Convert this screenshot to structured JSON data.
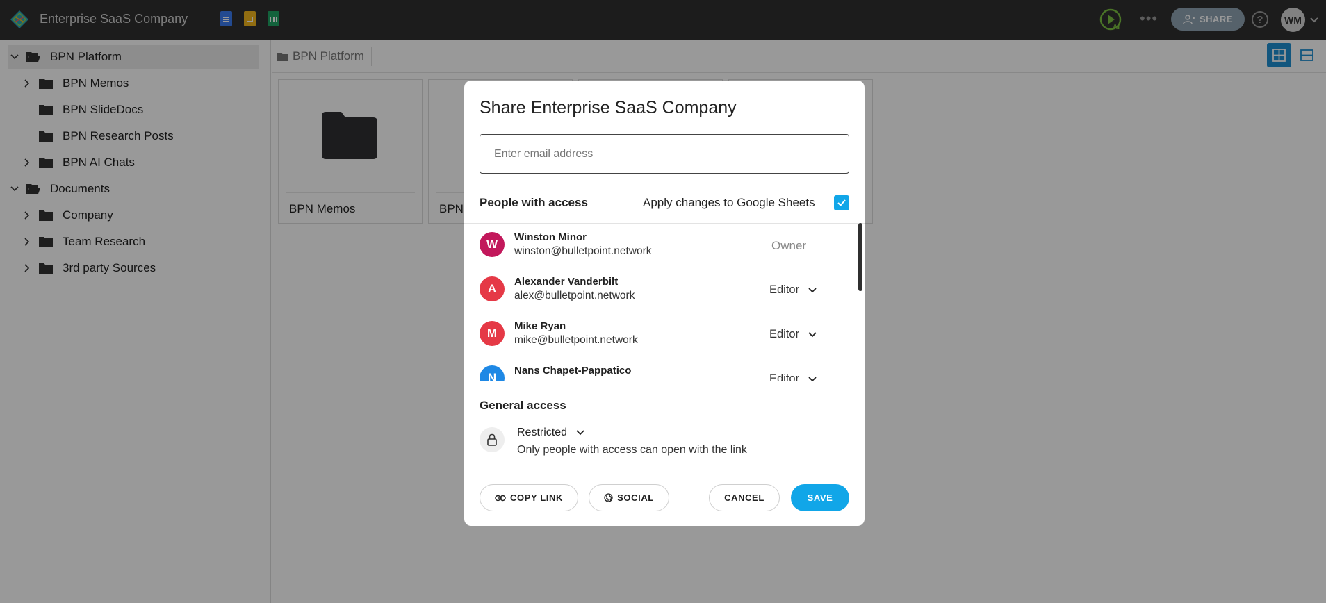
{
  "app": {
    "title": "Enterprise SaaS Company",
    "doc_icons": [
      "google-docs-icon",
      "google-slides-icon",
      "google-sheets-icon"
    ],
    "share_label": "SHARE",
    "help_icon": "help-icon",
    "user_initials": "WM",
    "ai_label": "AI",
    "colors": {
      "topbar": "#2f2f2f",
      "accent": "#11a6e8",
      "docs": "#3b7cf0",
      "slides": "#f2b61d",
      "sheets": "#21a464"
    }
  },
  "sidebar": {
    "items": [
      {
        "label": "BPN Platform",
        "level": 0,
        "expanded": true,
        "selected": true
      },
      {
        "label": "BPN Memos",
        "level": 1,
        "expandable": true
      },
      {
        "label": "BPN SlideDocs",
        "level": 1,
        "expandable": false
      },
      {
        "label": "BPN Research Posts",
        "level": 1,
        "expandable": false
      },
      {
        "label": "BPN AI Chats",
        "level": 1,
        "expandable": true
      },
      {
        "label": "Documents",
        "level": 0,
        "expanded": true
      },
      {
        "label": "Company",
        "level": 1,
        "expandable": true
      },
      {
        "label": "Team Research",
        "level": 1,
        "expandable": true
      },
      {
        "label": "3rd party Sources",
        "level": 1,
        "expandable": true
      }
    ]
  },
  "content": {
    "breadcrumb": "BPN Platform",
    "cards": [
      {
        "label": "BPN Memos"
      },
      {
        "label": "BPN"
      }
    ]
  },
  "modal": {
    "title": "Share Enterprise SaaS Company",
    "email_placeholder": "Enter email address",
    "people_title": "People with access",
    "apply_label": "Apply changes to Google Sheets",
    "apply_checked": true,
    "people": [
      {
        "initial": "W",
        "name": "Winston Minor",
        "email": "winston@bulletpoint.network",
        "role": "Owner",
        "color": "#c2185b"
      },
      {
        "initial": "A",
        "name": "Alexander Vanderbilt",
        "email": "alex@bulletpoint.network",
        "role": "Editor",
        "color": "#e53946"
      },
      {
        "initial": "M",
        "name": "Mike Ryan",
        "email": "mike@bulletpoint.network",
        "role": "Editor",
        "color": "#e53946"
      },
      {
        "initial": "N",
        "name": "Nans Chapet-Pappatico",
        "email": "",
        "role": "Editor",
        "color": "#1e88e5"
      }
    ],
    "general_access_title": "General access",
    "general_access_value": "Restricted",
    "general_access_desc": "Only people with access can open with the link",
    "copy_link_label": "COPY LINK",
    "social_label": "SOCIAL",
    "cancel_label": "CANCEL",
    "save_label": "SAVE"
  }
}
